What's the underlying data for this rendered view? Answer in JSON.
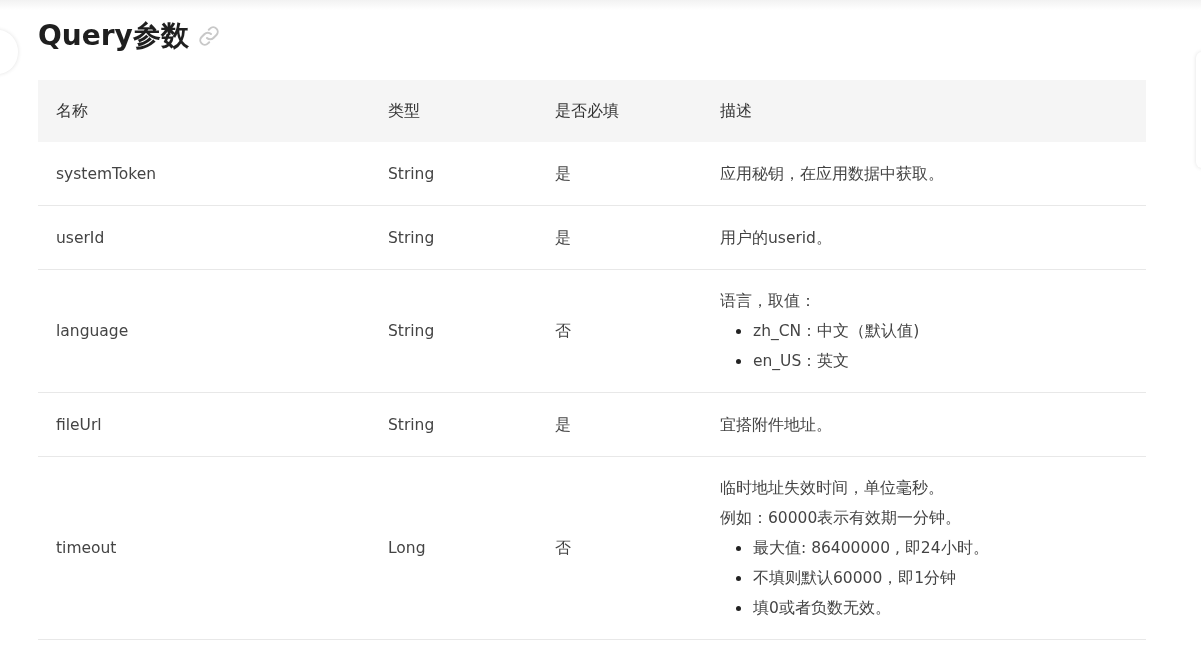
{
  "heading": {
    "title": "Query参数"
  },
  "table": {
    "columns": [
      "名称",
      "类型",
      "是否必填",
      "描述"
    ],
    "rows": [
      {
        "name": "systemToken",
        "type": "String",
        "required": "是",
        "description": {
          "lines": [
            "应用秘钥，在应用数据中获取。"
          ]
        }
      },
      {
        "name": "userId",
        "type": "String",
        "required": "是",
        "description": {
          "lines": [
            "用户的userid。"
          ]
        }
      },
      {
        "name": "language",
        "type": "String",
        "required": "否",
        "description": {
          "lines": [
            "语言，取值："
          ],
          "bullets": [
            "zh_CN：中文（默认值)",
            "en_US：英文"
          ]
        }
      },
      {
        "name": "fileUrl",
        "type": "String",
        "required": "是",
        "description": {
          "lines": [
            "宜搭附件地址。"
          ]
        }
      },
      {
        "name": "timeout",
        "type": "Long",
        "required": "否",
        "description": {
          "lines": [
            "临时地址失效时间，单位毫秒。",
            "例如：60000表示有效期一分钟。"
          ],
          "bullets": [
            "最大值: 86400000 , 即24小时。",
            "不填则默认60000，即1分钟",
            "填0或者负数无效。"
          ]
        }
      }
    ]
  }
}
